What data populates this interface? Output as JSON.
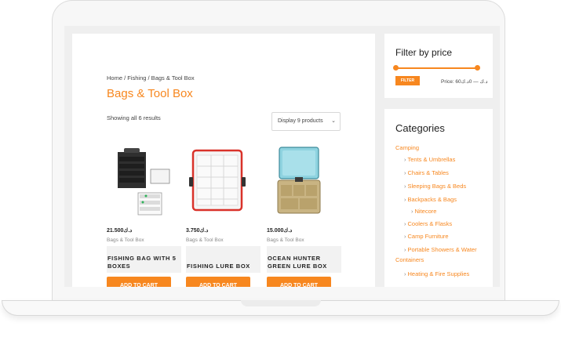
{
  "breadcrumb": "Home / Fishing / Bags & Tool Box",
  "page_title": "Bags & Tool Box",
  "result_count": "Showing all 6 results",
  "sort": {
    "selected": "Display 9 products"
  },
  "currency": "د.ك",
  "products": [
    {
      "price": "21.500د.ك",
      "category": "Bags & Tool Box",
      "name": "FISHING BAG WITH 5 BOXES",
      "button": "ADD TO CART"
    },
    {
      "price": "3.750د.ك",
      "category": "Bags & Tool Box",
      "name": "FISHING LURE BOX",
      "button": "ADD TO CART"
    },
    {
      "price": "15.000د.ك",
      "category": "Bags & Tool Box",
      "name": "OCEAN HUNTER GREEN LURE BOX",
      "button": "ADD TO CART"
    }
  ],
  "price_filter": {
    "title": "Filter by price",
    "button": "FILTER",
    "range_text": "Price: 60د.ك — 0د.ك"
  },
  "categories": {
    "title": "Categories",
    "items": [
      {
        "label": "Camping"
      },
      {
        "label": "Tents & Umbrellas"
      },
      {
        "label": "Chairs & Tables"
      },
      {
        "label": "Sleeping Bags & Beds"
      },
      {
        "label": "Backpacks & Bags"
      },
      {
        "label": "Nitecore"
      },
      {
        "label": "Coolers & Flasks"
      },
      {
        "label": "Camp Furniture"
      },
      {
        "label": "Portable Showers & Water"
      },
      {
        "label": "Containers"
      },
      {
        "label": "Heating & Fire Supplies"
      }
    ]
  },
  "colors": {
    "accent": "#f7871f"
  }
}
